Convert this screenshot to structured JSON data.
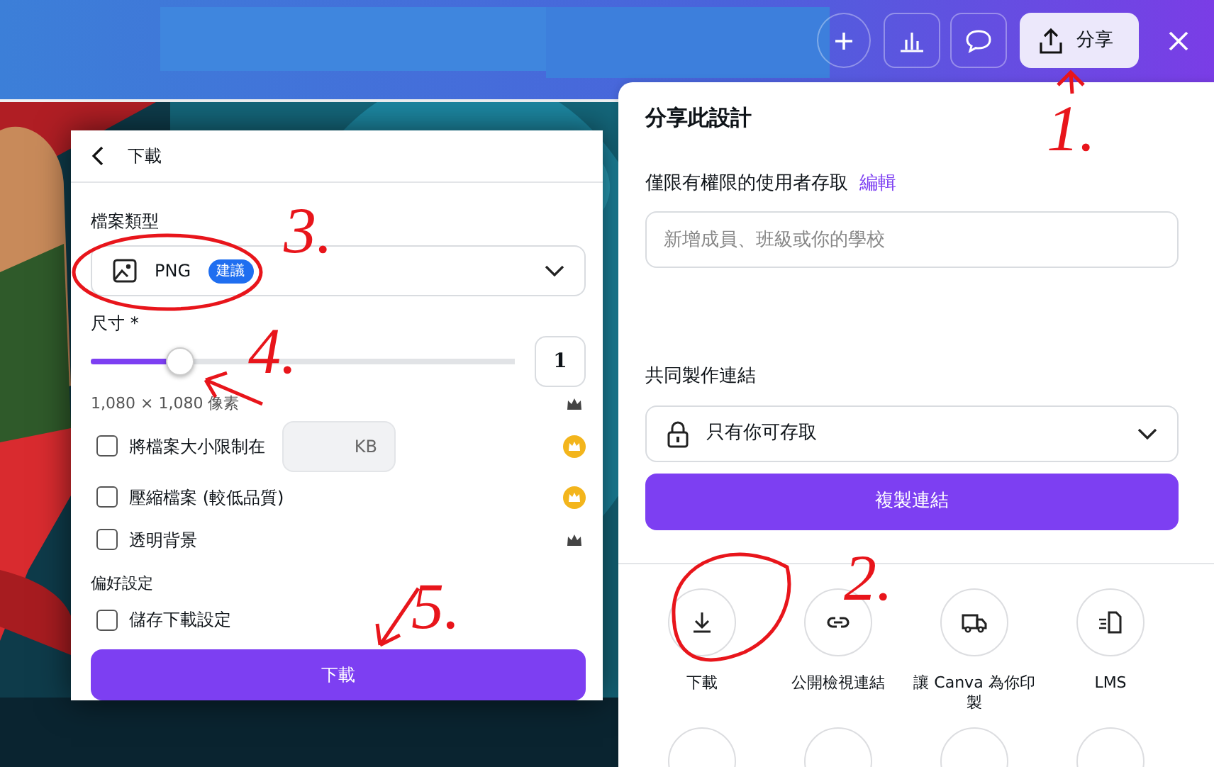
{
  "top_bar": {
    "share_button": "分享"
  },
  "download_panel": {
    "title": "下載",
    "file_type_label": "檔案類型",
    "file_type": "PNG",
    "file_type_badge": "建議",
    "size_label": "尺寸 *",
    "size_slider": {
      "level": 0.21
    },
    "size_value": "1",
    "dimensions": {
      "text": "1,080 × 1,080 像素",
      "kind": "crown"
    },
    "options": [
      {
        "kind": "gold-crown",
        "label": "將檔案大小限制在",
        "unit": "KB",
        "checked": false
      },
      {
        "kind": "gold-crown",
        "label": "壓縮檔案 (較低品質)",
        "checked": false
      },
      {
        "kind": "crown",
        "label": "透明背景",
        "checked": false
      }
    ],
    "prefs_label": "偏好設定",
    "prefs_options": [
      {
        "label": "儲存下載設定",
        "checked": false
      }
    ],
    "download_button": "下載"
  },
  "share_panel": {
    "title": "分享此設計",
    "access_text": "僅限有權限的使用者存取",
    "edit_link": "編輯",
    "invite_field": {
      "placeholder": "新增成員、班級或你的學校"
    },
    "collab_label": "共同製作連結",
    "access_select": "只有你可存取",
    "copy_button": "複製連結",
    "options": [
      {
        "kind": "download",
        "label": "下載"
      },
      {
        "kind": "link",
        "label": "公開檢視連結"
      },
      {
        "kind": "print",
        "label": "讓 Canva 為你印製"
      },
      {
        "kind": "lms",
        "label": "LMS"
      }
    ]
  },
  "annotations": [
    {
      "label": "1."
    },
    {
      "label": "2."
    },
    {
      "label": "3."
    },
    {
      "label": "4."
    },
    {
      "label": "5."
    }
  ]
}
